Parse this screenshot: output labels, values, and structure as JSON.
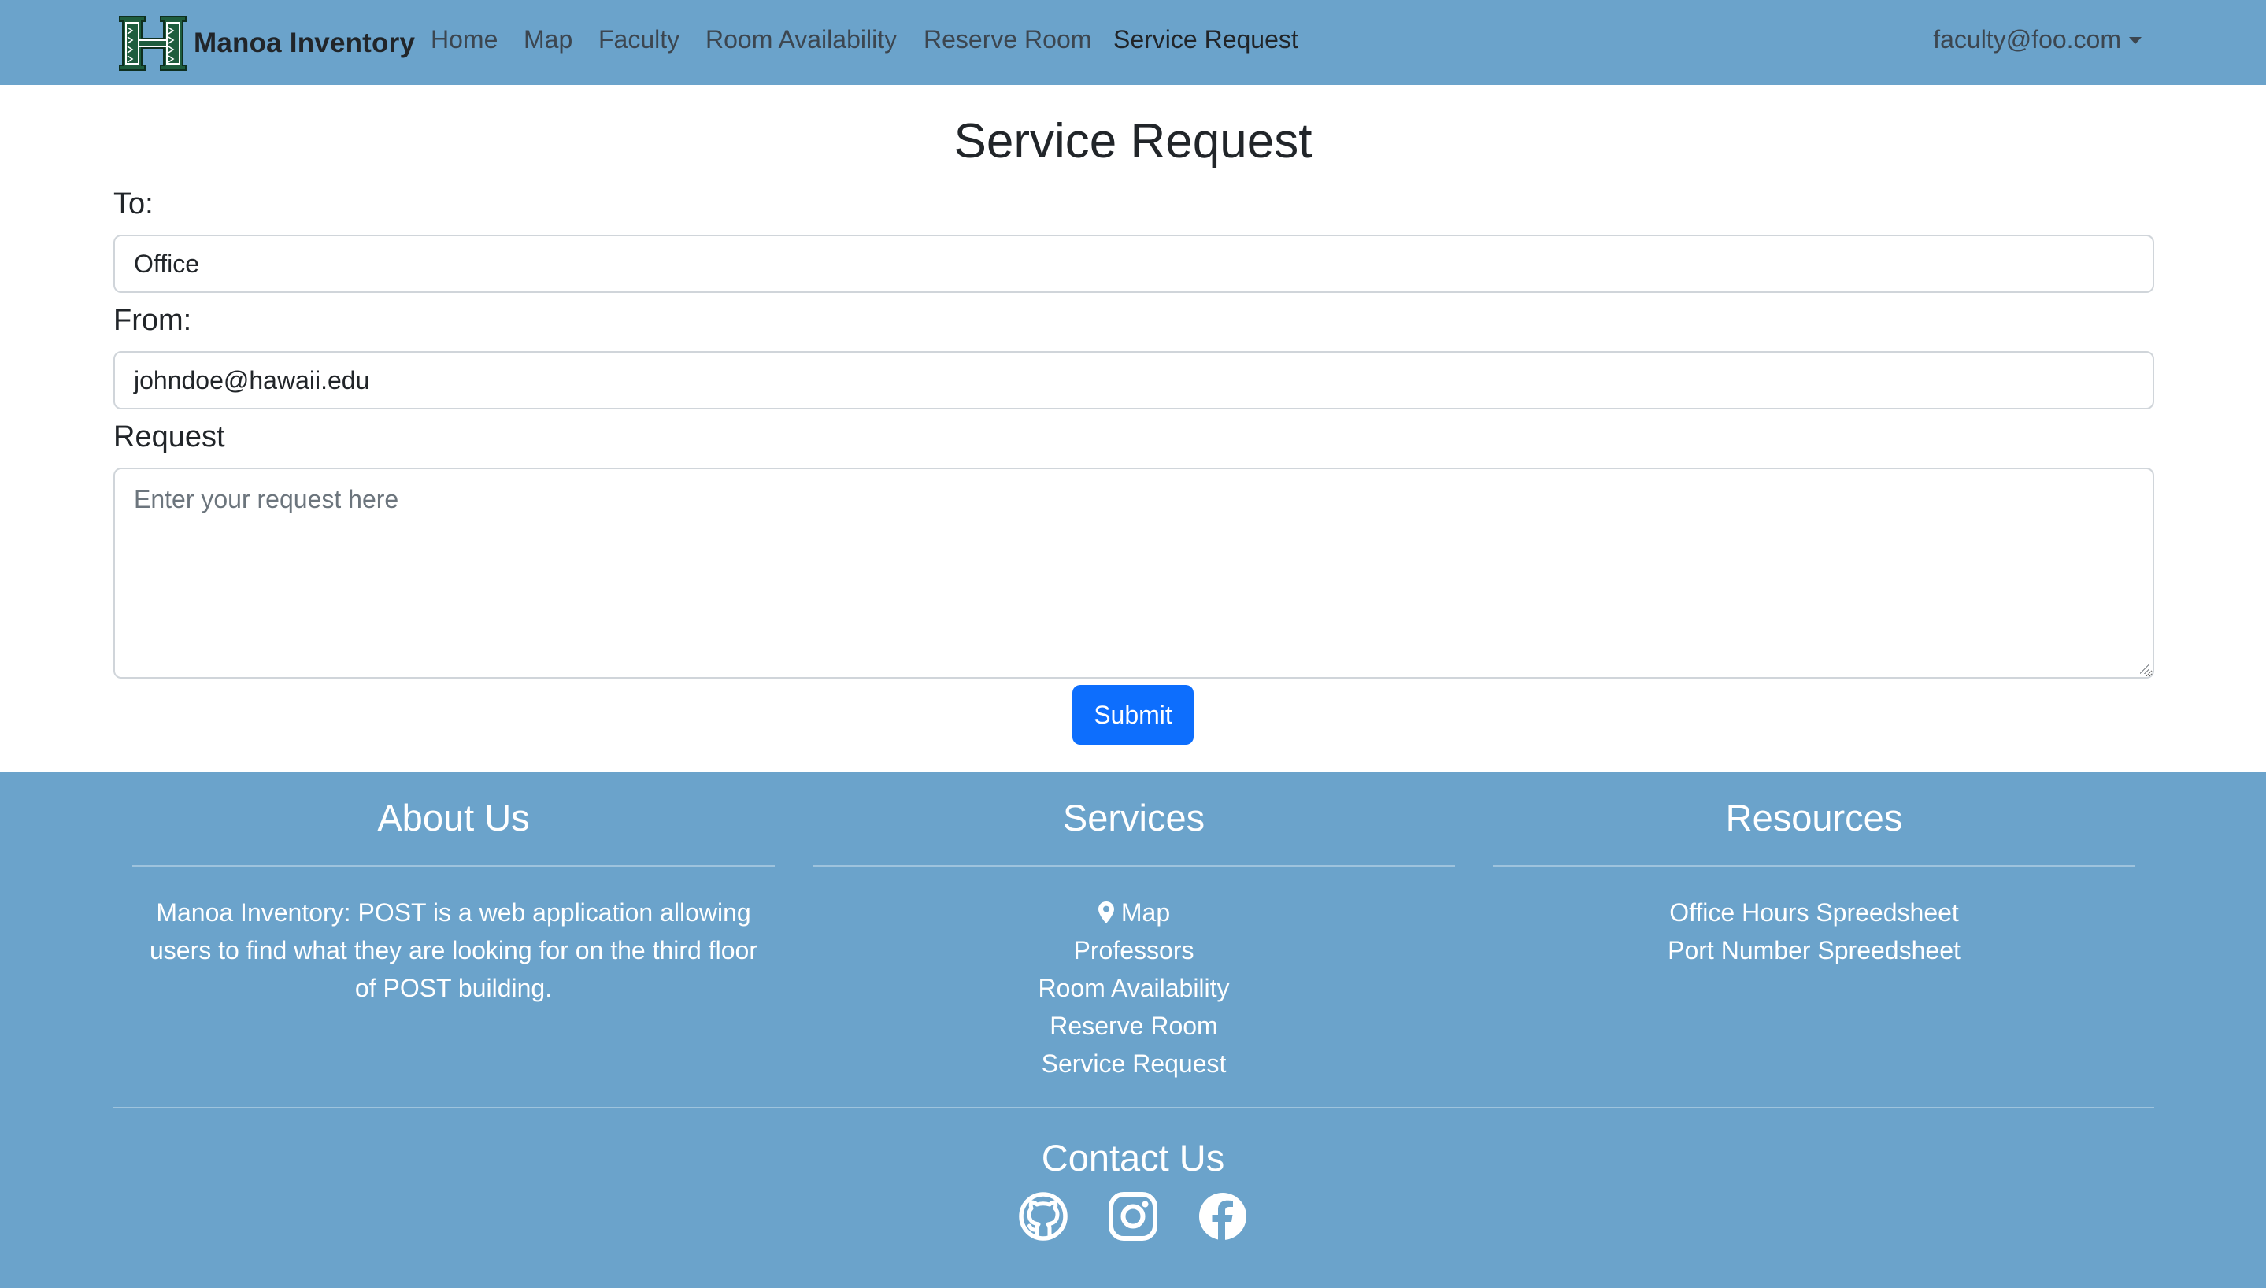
{
  "navbar": {
    "brand": "Manoa Inventory",
    "links": [
      {
        "label": "Home"
      },
      {
        "label": "Map"
      },
      {
        "label": "Faculty"
      },
      {
        "label": "Room Availability"
      },
      {
        "label": "Reserve Room"
      },
      {
        "label": "Service Request",
        "active": true
      }
    ],
    "user": "faculty@foo.com"
  },
  "form": {
    "title": "Service Request",
    "to_label": "To:",
    "to_value": "Office",
    "from_label": "From:",
    "from_value": "johndoe@hawaii.edu",
    "request_label": "Request",
    "request_placeholder": "Enter your request here",
    "submit_label": "Submit"
  },
  "footer": {
    "about": {
      "title": "About Us",
      "text": "Manoa Inventory: POST is a web application allowing users to find what they are looking for on the third floor of POST building."
    },
    "services": {
      "title": "Services",
      "items": [
        "Map",
        "Professors",
        "Room Availability",
        "Reserve Room",
        "Service Request"
      ]
    },
    "resources": {
      "title": "Resources",
      "items": [
        "Office Hours Spreedsheet",
        "Port Number Spreedsheet"
      ]
    },
    "contact": {
      "title": "Contact Us",
      "icons": [
        "github-icon",
        "instagram-icon",
        "facebook-icon"
      ]
    }
  },
  "colors": {
    "navbar_bg": "#6ba3cb",
    "footer_bg": "#6ba3cb",
    "primary_button": "#0d6efd",
    "logo_green": "#1e5c3d"
  }
}
